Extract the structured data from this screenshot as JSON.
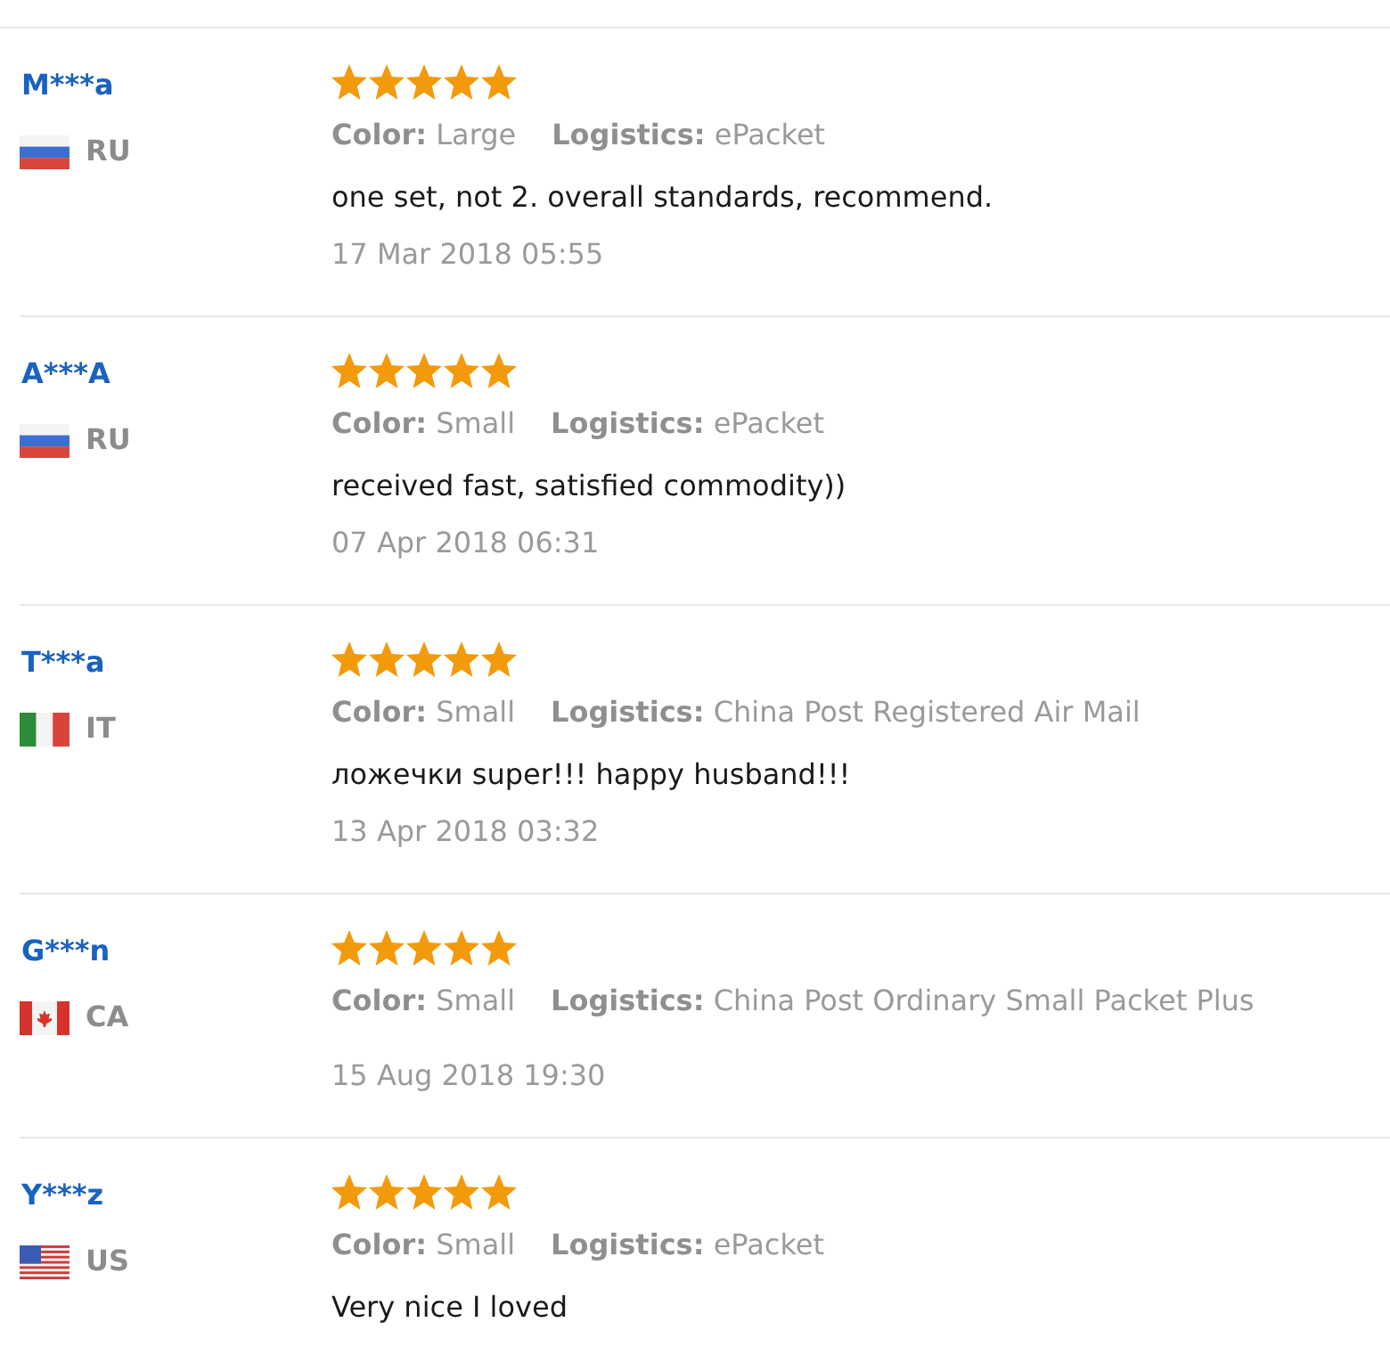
{
  "reviews": [
    {
      "name": "M***a",
      "flag": {
        "kind": "russia"
      },
      "country": "RU",
      "stars": 5,
      "attributes": [
        {
          "label": "Color:",
          "value": "Large"
        },
        {
          "label": "Logistics:",
          "value": "ePacket"
        }
      ],
      "text": "one set, not 2. overall standards, recommend.",
      "date": "17 Mar 2018 05:55"
    },
    {
      "name": "A***A",
      "flag": {
        "kind": "russia"
      },
      "country": "RU",
      "stars": 5,
      "attributes": [
        {
          "label": "Color:",
          "value": "Small"
        },
        {
          "label": "Logistics:",
          "value": "ePacket"
        }
      ],
      "text": "received fast, satisfied commodity))",
      "date": "07 Apr 2018 06:31"
    },
    {
      "name": "T***a",
      "flag": {
        "kind": "italy"
      },
      "country": "IT",
      "stars": 5,
      "attributes": [
        {
          "label": "Color:",
          "value": "Small"
        },
        {
          "label": "Logistics:",
          "value": "China Post Registered Air Mail"
        }
      ],
      "text": "ложечки super!!! happy husband!!!",
      "date": "13 Apr 2018 03:32"
    },
    {
      "name": "G***n",
      "flag": {
        "kind": "canada"
      },
      "country": "CA",
      "stars": 5,
      "attributes": [
        {
          "label": "Color:",
          "value": "Small"
        },
        {
          "label": "Logistics:",
          "value": "China Post Ordinary Small Packet Plus"
        }
      ],
      "date": "15 Aug 2018 19:30"
    },
    {
      "name": "Y***z",
      "flag": {
        "kind": "usa"
      },
      "country": "US",
      "stars": 5,
      "attributes": [
        {
          "label": "Color:",
          "value": "Small"
        },
        {
          "label": "Logistics:",
          "value": "ePacket"
        }
      ],
      "text": "Very nice I loved"
    }
  ]
}
